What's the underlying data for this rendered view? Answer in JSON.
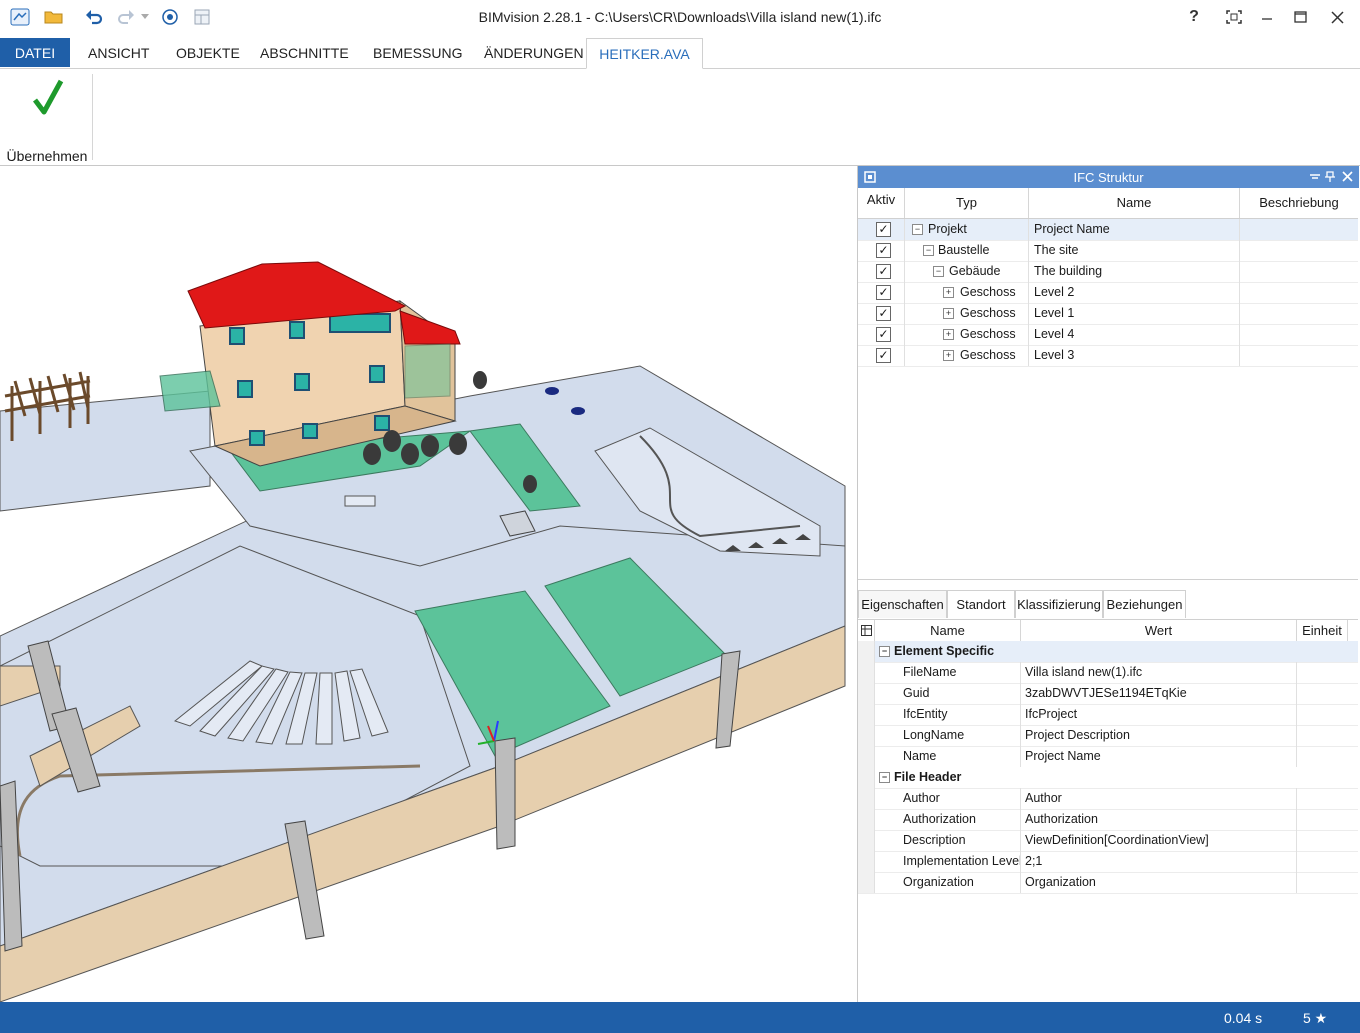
{
  "window": {
    "title": "BIMvision 2.28.1 - C:\\Users\\CR\\Downloads\\Villa island new(1).ifc",
    "help_label": "?"
  },
  "ribbon": {
    "tabs": [
      {
        "label": "DATEI"
      },
      {
        "label": "ANSICHT"
      },
      {
        "label": "OBJEKTE"
      },
      {
        "label": "ABSCHNITTE"
      },
      {
        "label": "BEMESSUNG"
      },
      {
        "label": "ÄNDERUNGEN"
      },
      {
        "label": "HEITKER.AVA"
      }
    ],
    "active_tab": "HEITKER.AVA",
    "apply_label": "Übernehmen"
  },
  "ifc_panel": {
    "title": "IFC Struktur",
    "columns": {
      "aktiv": "Aktiv",
      "typ": "Typ",
      "name": "Name",
      "beschreibung": "Beschriebung"
    },
    "rows": [
      {
        "typ": "Projekt",
        "name": "Project Name",
        "checked": true,
        "expander": "−"
      },
      {
        "typ": "Baustelle",
        "name": "The site",
        "checked": true,
        "expander": "−"
      },
      {
        "typ": "Gebäude",
        "name": "The building",
        "checked": true,
        "expander": "−"
      },
      {
        "typ": "Geschoss",
        "name": "Level 2",
        "checked": true,
        "expander": "+"
      },
      {
        "typ": "Geschoss",
        "name": "Level 1",
        "checked": true,
        "expander": "+"
      },
      {
        "typ": "Geschoss",
        "name": "Level 4",
        "checked": true,
        "expander": "+"
      },
      {
        "typ": "Geschoss",
        "name": "Level 3",
        "checked": true,
        "expander": "+"
      }
    ]
  },
  "properties": {
    "tabs": [
      {
        "label": "Eigenschaften"
      },
      {
        "label": "Standort"
      },
      {
        "label": "Klassifizierung"
      },
      {
        "label": "Beziehungen"
      }
    ],
    "columns": {
      "name": "Name",
      "wert": "Wert",
      "einheit": "Einheit"
    },
    "groups": [
      {
        "title": "Element Specific",
        "rows": [
          {
            "name": "FileName",
            "value": "Villa island new(1).ifc"
          },
          {
            "name": "Guid",
            "value": "3zabDWVTJESe1194ETqKie"
          },
          {
            "name": "IfcEntity",
            "value": "IfcProject"
          },
          {
            "name": "LongName",
            "value": "Project Description"
          },
          {
            "name": "Name",
            "value": "Project Name"
          }
        ]
      },
      {
        "title": "File Header",
        "rows": [
          {
            "name": "Author",
            "value": "Author"
          },
          {
            "name": "Authorization",
            "value": "Authorization"
          },
          {
            "name": "Description",
            "value": "ViewDefinition[CoordinationView]"
          },
          {
            "name": "Implementation Level",
            "value": "2;1"
          },
          {
            "name": "Organization",
            "value": "Organization"
          }
        ]
      }
    ]
  },
  "status": {
    "render_time": "0.04 s",
    "rating": "5 ★"
  },
  "colors": {
    "accent": "#1f5fa8",
    "panel_title": "#5b8ed0",
    "roof": "#e01818",
    "lawn": "#5cc39a",
    "wall": "#e6cfae",
    "pavement": "#d2dcec"
  }
}
